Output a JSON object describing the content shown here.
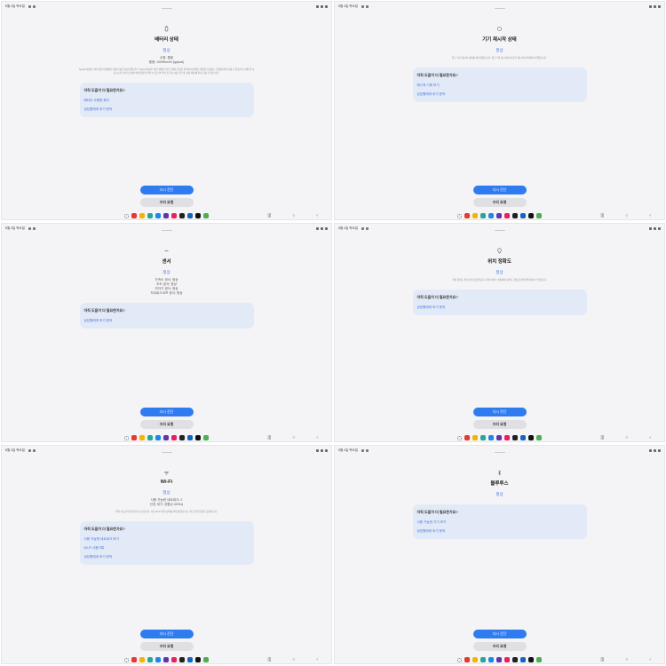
{
  "colors": {
    "accent": "#2f7bf0",
    "link": "#3c6fd8",
    "help_bg": "#e3eaf7",
    "panel_bg": "#f4f4f6",
    "taskbar_apps": [
      "#e53935",
      "#f4b400",
      "#26a69a",
      "#1e88e5",
      "#5e35b1",
      "#e91e63",
      "#212121",
      "#1565c0",
      "#111111",
      "#4caf50"
    ]
  },
  "status_bar": {
    "time": "8월 4일 목요일"
  },
  "common": {
    "good_status": "정상",
    "help_question": "아직 도움이 더 필요한가요?",
    "counsel_link": "상담원에게 후기 문의",
    "retest_button": "다시 진단",
    "repair_button": "수리 요청"
  },
  "panels": [
    {
      "icon": "battery-icon",
      "title": "배터리 상태",
      "details": [
        "수명: 좋음",
        "용량: 10090mAh (typical)"
      ],
      "desc": "Typical 용량은 여러 실험 환경에서 측정된 평균 용량 값입니다. Typical 용량은 여러 상황과 테스트에서 측정한 결과이며 실제로 제품을 사용하는 환경에 따라 다를 수 있습니다. 배터리 사용 시간은 여러 요인에 의해 영향을 받을 수 있으며 주변 온도와 사용 기간 및 사용 패턴에 따라 다를 수 있습니다.",
      "links": [
        "배터리 사용량 확인",
        "상담원에게 후기 문의"
      ]
    },
    {
      "icon": "restart-icon",
      "title": "기기 재시작 상태",
      "details": [],
      "desc": "최근 기기 재시작 상태를 확인하였습니다. 최근 7일 동안 예기치 않은 재시작이 발생하지 않았습니다.",
      "links": [
        "예시적 기록 보기",
        "상담원에게 후기 문의"
      ]
    },
    {
      "icon": "sensor-icon",
      "title": "센서",
      "details": [
        "가속도 센서: 정상",
        "조도 센서: 정상",
        "지자기 센서: 정상",
        "자이로스코프 센서: 정상"
      ],
      "desc": "",
      "links": [
        "상담원에게 후기 문의"
      ]
    },
    {
      "icon": "location-icon",
      "title": "위치 정확도",
      "details": [],
      "desc": "위치 정확도 확인 결과 정상입니다. 위치 서비스 설정에서 정확도 향상 옵션을 확인하실 수 있습니다.",
      "links": [
        "상담원에게 후기 문의"
      ]
    },
    {
      "icon": "wifi-icon",
      "title": "Wi-Fi",
      "details": [
        "사용 가능한 네트워크: 2",
        "신호 세기: 강함(2.4GHz)"
      ],
      "desc": "연결 가능한 네트워크가 표시됩니다. 기본 Wi-Fi 연결 상태를 확인하였습니다. 최근 연결 품질은 정상입니다.",
      "links": [
        "사용 가능한 네트워크 보기",
        "Wi-Fi 사용기록",
        "상담원에게 후기 문의"
      ]
    },
    {
      "icon": "bluetooth-icon",
      "title": "블루투스",
      "details": [],
      "desc": "",
      "links": [
        "사용 가능한 기기 보기",
        "상담원에게 후기 문의"
      ]
    }
  ]
}
